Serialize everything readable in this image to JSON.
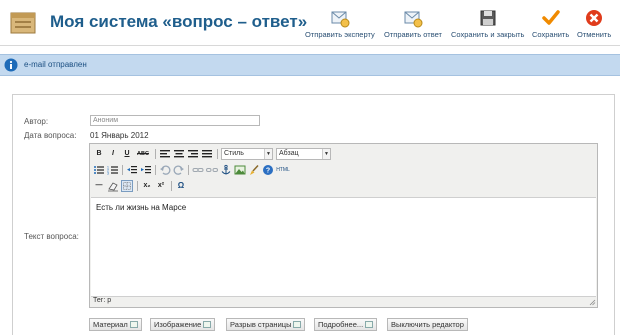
{
  "header": {
    "title": "Моя система «вопрос – ответ»",
    "buttons": [
      {
        "label": "Отправить эксперту",
        "icon": "send-to-expert-icon"
      },
      {
        "label": "Отправить ответ",
        "icon": "send-answer-icon"
      },
      {
        "label": "Сохранить и закрыть",
        "icon": "save-close-icon"
      },
      {
        "label": "Сохранить",
        "icon": "checkmark-icon"
      },
      {
        "label": "Отменить",
        "icon": "cancel-icon"
      }
    ]
  },
  "message": {
    "text": "e-mail отправлен",
    "icon": "info-icon"
  },
  "form": {
    "author_label": "Автор:",
    "author_value": "Аноним",
    "date_label": "Дата вопроса:",
    "date_value": "01 Январь 2012",
    "question_label": "Текст вопроса:"
  },
  "editor": {
    "style_select": "Стиль",
    "format_select": "Абзац",
    "html_label": "HTML",
    "content": "Есть ли жизнь на Марсе",
    "path": "Тег: p",
    "toolbar_row1": [
      "B",
      "I",
      "U",
      "ABC"
    ],
    "toolbar_row3": [
      "—",
      "x₂",
      "x²",
      "Ω"
    ]
  },
  "bottom_buttons": [
    {
      "label": "Материал"
    },
    {
      "label": "Изображение"
    },
    {
      "label": "Разрыв страницы"
    },
    {
      "label": "Подробнее..."
    },
    {
      "label": "Выключить редактор"
    }
  ],
  "colors": {
    "title": "#1f5e8c",
    "message_bg": "#c3d9ef",
    "save_check": "#f08a00",
    "cancel_red": "#e03c1c"
  }
}
